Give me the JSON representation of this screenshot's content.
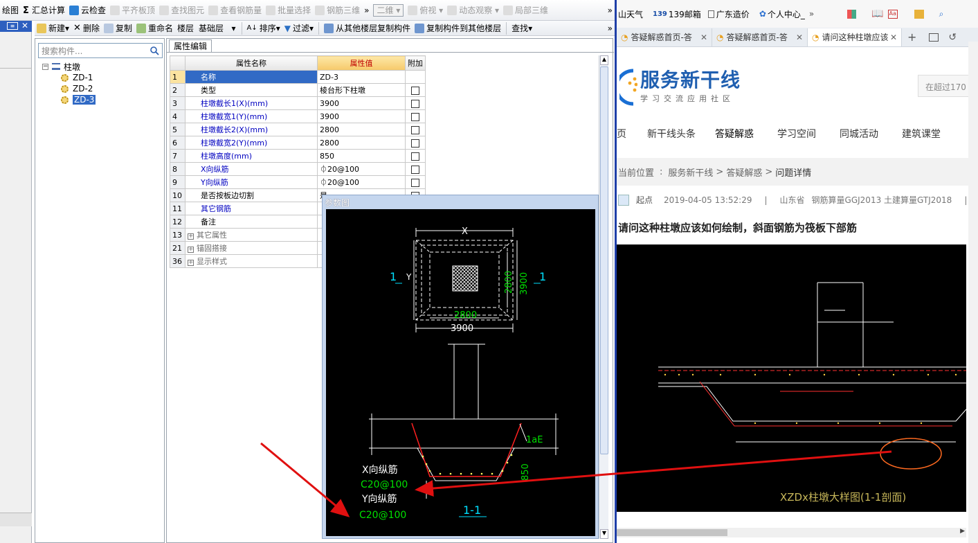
{
  "toolbar_top": {
    "items": [
      "绘图",
      "汇总计算",
      "云检查",
      "平齐板顶",
      "查找图元",
      "查看钢筋量",
      "批量选择",
      "钢筋三维",
      "二维",
      "俯视",
      "动态观察",
      "局部三维"
    ],
    "more": "»"
  },
  "toolbar_second": {
    "items": [
      "新建",
      "删除",
      "复制",
      "重命名",
      "楼层",
      "基础层",
      "排序",
      "过滤",
      "从其他楼层复制构件",
      "复制构件到其他楼层",
      "查找"
    ],
    "more": "»"
  },
  "tree": {
    "search_placeholder": "搜索构件...",
    "root": "柱墩",
    "children": [
      "ZD-1",
      "ZD-2",
      "ZD-3"
    ],
    "selected": "ZD-3"
  },
  "properties": {
    "tab": "属性编辑",
    "headers": {
      "num": "",
      "name": "属性名称",
      "value": "属性值",
      "extra": "附加"
    },
    "rows": [
      {
        "n": "1",
        "name": "名称",
        "value": "ZD-3",
        "chk": false,
        "style": "sel"
      },
      {
        "n": "2",
        "name": "类型",
        "value": "棱台形下柱墩",
        "chk": true,
        "style": "black"
      },
      {
        "n": "3",
        "name": "柱墩截长1(X)(mm)",
        "value": "3900",
        "chk": true,
        "style": "blue"
      },
      {
        "n": "4",
        "name": "柱墩截宽1(Y)(mm)",
        "value": "3900",
        "chk": true,
        "style": "blue"
      },
      {
        "n": "5",
        "name": "柱墩截长2(X)(mm)",
        "value": "2800",
        "chk": true,
        "style": "blue"
      },
      {
        "n": "6",
        "name": "柱墩截宽2(Y)(mm)",
        "value": "2800",
        "chk": true,
        "style": "blue"
      },
      {
        "n": "7",
        "name": "柱墩高度(mm)",
        "value": "850",
        "chk": true,
        "style": "blue"
      },
      {
        "n": "8",
        "name": "X向纵筋",
        "value": "⏀20@100",
        "chk": true,
        "style": "blue"
      },
      {
        "n": "9",
        "name": "Y向纵筋",
        "value": "⏀20@100",
        "chk": true,
        "style": "blue"
      },
      {
        "n": "10",
        "name": "是否按板边切割",
        "value": "是",
        "chk": true,
        "style": "black"
      },
      {
        "n": "11",
        "name": "其它钢筋",
        "value": "",
        "chk": false,
        "style": "blue"
      },
      {
        "n": "12",
        "name": "备注",
        "value": "",
        "chk": false,
        "style": "black"
      },
      {
        "n": "13",
        "name": "其它属性",
        "value": "",
        "chk": false,
        "style": "group"
      },
      {
        "n": "21",
        "name": "锚固搭接",
        "value": "",
        "chk": false,
        "style": "group"
      },
      {
        "n": "36",
        "name": "显示样式",
        "value": "",
        "chk": false,
        "style": "group"
      }
    ]
  },
  "reference": {
    "title": "参数图",
    "x_label": "X",
    "y_label": "Y",
    "sec": "1",
    "dim_2800": "2800",
    "dim_3900": "3900",
    "lae": "1aE",
    "h850": "850",
    "xbar_label": "X向纵筋",
    "xbar_val": "C20@100",
    "ybar_label": "Y向纵筋",
    "ybar_val": "C20@100",
    "section": "1-1"
  },
  "browser": {
    "bookmarks": [
      "山天气",
      "139邮箱",
      "广东造价",
      "个人中心_"
    ],
    "tabs": [
      "答疑解惑首页-答",
      "答疑解惑首页-答",
      "请问这种柱墩应该"
    ],
    "logo_title": "服务新干线",
    "logo_sub": "学习交流应用社区",
    "search_hint": "在超过170",
    "nav": [
      "页",
      "新干线头条",
      "答疑解惑",
      "学习空间",
      "同城活动",
      "建筑课堂"
    ],
    "crumb_prefix": "当前位置",
    "crumb": [
      "服务新干线",
      "答疑解惑",
      "问题详情"
    ],
    "meta_user": "起点",
    "meta_time": "2019-04-05 13:52:29",
    "meta_region": "山东省",
    "meta_tags": "钢筋算量GGJ2013 土建算量GTJ2018",
    "question": "请问这种柱墩应该如何绘制，斜面钢筋为筏板下部筋",
    "cad_caption": "XZDx柱墩大样图(1-1剖面)"
  },
  "colors": {
    "cad_green": "#00e000",
    "cad_cyan": "#00e0ff",
    "cad_red": "#ff2020",
    "annot_red": "#e01010",
    "selection": "#316ac5"
  }
}
